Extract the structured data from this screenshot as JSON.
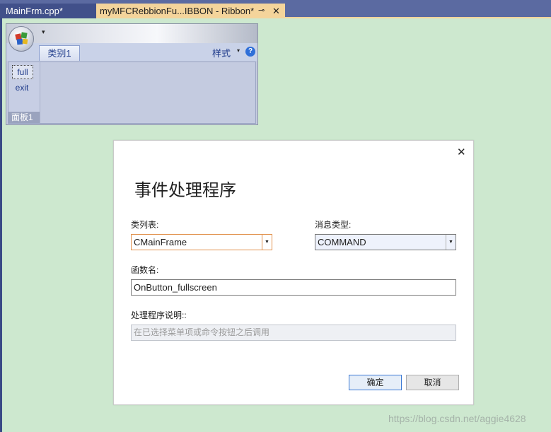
{
  "tabs": [
    {
      "label": "MainFrm.cpp*",
      "active": false
    },
    {
      "label": "myMFCRebbionFu...IBBON - Ribbon*",
      "active": true
    }
  ],
  "tab_pin_icon": "pin-icon",
  "tab_close_icon": "close-icon",
  "ribbon": {
    "qat_dropdown_glyph": "▾",
    "category_tab": "类别1",
    "style_label": "样式",
    "style_arrow": "▾",
    "help_glyph": "?",
    "buttons": [
      "full",
      "exit"
    ],
    "panel_caption": "面板1"
  },
  "dialog": {
    "close_glyph": "✕",
    "title": "事件处理程序",
    "class_list_label": "类列表:",
    "class_list_value": "CMainFrame",
    "message_type_label": "消息类型:",
    "message_type_value": "COMMAND",
    "function_name_label": "函数名:",
    "function_name_value": "OnButton_fullscreen",
    "handler_desc_label": "处理程序说明::",
    "handler_desc_value": "在已选择菜单项或命令按钮之后调用",
    "ok_label": "确定",
    "cancel_label": "取消"
  },
  "watermark": "https://blog.csdn.net/aggie4628",
  "colors": {
    "background": "#cde8cf",
    "tab_strip": "#5b6aa1",
    "active_tab": "#f4d49b",
    "ribbon_bg": "#c4cbe0",
    "accent_orange": "#e1914c"
  }
}
